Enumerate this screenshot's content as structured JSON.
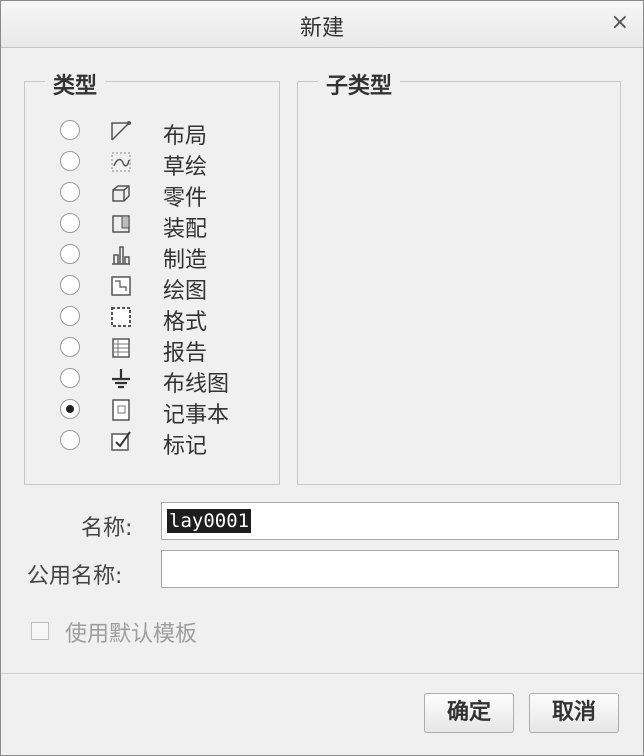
{
  "dialog": {
    "title": "新建",
    "close_label": "×"
  },
  "type_group": {
    "legend": "类型",
    "items": [
      {
        "label": "布局",
        "icon": "layout-icon",
        "selected": false
      },
      {
        "label": "草绘",
        "icon": "sketch-icon",
        "selected": false
      },
      {
        "label": "零件",
        "icon": "part-icon",
        "selected": false
      },
      {
        "label": "装配",
        "icon": "assembly-icon",
        "selected": false
      },
      {
        "label": "制造",
        "icon": "manufacturing-icon",
        "selected": false
      },
      {
        "label": "绘图",
        "icon": "drawing-icon",
        "selected": false
      },
      {
        "label": "格式",
        "icon": "format-icon",
        "selected": false
      },
      {
        "label": "报告",
        "icon": "report-icon",
        "selected": false
      },
      {
        "label": "布线图",
        "icon": "diagram-icon",
        "selected": false
      },
      {
        "label": "记事本",
        "icon": "notebook-icon",
        "selected": true
      },
      {
        "label": "标记",
        "icon": "markup-icon",
        "selected": false
      }
    ]
  },
  "subtype_group": {
    "legend": "子类型"
  },
  "name_field": {
    "label": "名称:",
    "value": "lay0001"
  },
  "common_name_field": {
    "label": "公用名称:",
    "value": ""
  },
  "default_template": {
    "label": "使用默认模板",
    "checked": false,
    "enabled": false
  },
  "buttons": {
    "ok": "确定",
    "cancel": "取消"
  }
}
